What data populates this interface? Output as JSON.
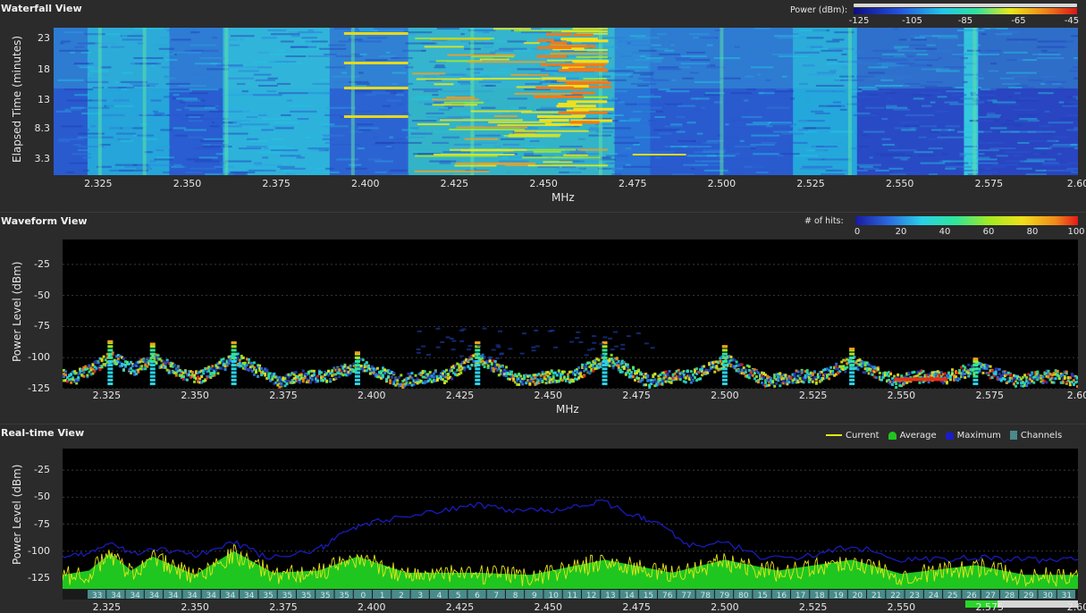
{
  "waterfall": {
    "title": "Waterfall View",
    "colorbar_label": "Power (dBm):",
    "colorbar_ticks": [
      "-125",
      "-105",
      "-85",
      "-65",
      "-45"
    ],
    "ylabel": "Elapsed Time (minutes)",
    "xlabel": "MHz"
  },
  "waveform": {
    "title": "Waveform View",
    "colorbar_label": "# of hits:",
    "colorbar_ticks": [
      "0",
      "20",
      "40",
      "60",
      "80",
      "100"
    ],
    "ylabel": "Power Level (dBm)",
    "xlabel": "MHz"
  },
  "realtime": {
    "title": "Real-time View",
    "ylabel": "Power Level (dBm)",
    "legend": [
      "Current",
      "Average",
      "Maximum",
      "Channels"
    ]
  },
  "colors": {
    "current": "#e6e619",
    "average": "#1fc61f",
    "maximum": "#1c1cc8",
    "channels": "#4a8a8a"
  },
  "chart_data": [
    {
      "type": "heatmap",
      "title": "Waterfall View",
      "ylabel": "Elapsed Time (minutes)",
      "xlabel": "MHz",
      "x_ticks": [
        "2.325",
        "2.350",
        "2.375",
        "2.400",
        "2.425",
        "2.450",
        "2.475",
        "2.500",
        "2.525",
        "2.550",
        "2.575",
        "2.60"
      ],
      "x_tick_values": [
        2.325,
        2.35,
        2.375,
        2.4,
        2.425,
        2.45,
        2.475,
        2.5,
        2.525,
        2.55,
        2.575,
        2.6
      ],
      "y_ticks": [
        "23",
        "18",
        "13",
        "8.3",
        "3.3"
      ],
      "y_tick_values": [
        23,
        18,
        13,
        8.3,
        3.3
      ],
      "xlim": [
        2.3125,
        2.6
      ],
      "ylim": [
        0.7,
        24.8
      ],
      "colorbar": {
        "label": "Power (dBm):",
        "ticks": [
          -125,
          -105,
          -85,
          -65,
          -45
        ]
      }
    },
    {
      "type": "heatmap",
      "title": "Waveform View",
      "ylabel": "Power Level (dBm)",
      "xlabel": "MHz",
      "x_ticks": [
        "2.325",
        "2.350",
        "2.375",
        "2.400",
        "2.425",
        "2.450",
        "2.475",
        "2.500",
        "2.525",
        "2.550",
        "2.575",
        "2.60"
      ],
      "x_tick_values": [
        2.325,
        2.35,
        2.375,
        2.4,
        2.425,
        2.45,
        2.475,
        2.5,
        2.525,
        2.55,
        2.575,
        2.6
      ],
      "y_ticks": [
        "-25",
        "-50",
        "-75",
        "-100",
        "-125"
      ],
      "y_tick_values": [
        -25,
        -50,
        -75,
        -100,
        -125
      ],
      "xlim": [
        2.3125,
        2.6
      ],
      "ylim": [
        -125,
        -5
      ],
      "colorbar": {
        "label": "# of hits:",
        "ticks": [
          0,
          20,
          40,
          60,
          80,
          100
        ]
      },
      "peaks": [
        {
          "x": 2.326,
          "y": -86
        },
        {
          "x": 2.338,
          "y": -88
        },
        {
          "x": 2.361,
          "y": -87
        },
        {
          "x": 2.396,
          "y": -95
        },
        {
          "x": 2.43,
          "y": -87
        },
        {
          "x": 2.466,
          "y": -87
        },
        {
          "x": 2.5,
          "y": -90
        },
        {
          "x": 2.536,
          "y": -92
        },
        {
          "x": 2.571,
          "y": -100
        }
      ]
    },
    {
      "type": "line",
      "title": "Real-time View",
      "ylabel": "Power Level (dBm)",
      "y_ticks": [
        "-25",
        "-50",
        "-75",
        "-100",
        "-125"
      ],
      "y_tick_values": [
        -25,
        -50,
        -75,
        -100,
        -125
      ],
      "xlim": [
        2.3125,
        2.6
      ],
      "ylim": [
        -135,
        -5
      ],
      "legend": "top-right",
      "series": [
        {
          "name": "Maximum",
          "x": [
            2.3125,
            2.32,
            2.326,
            2.332,
            2.338,
            2.35,
            2.361,
            2.37,
            2.384,
            2.39,
            2.397,
            2.405,
            2.42,
            2.43,
            2.44,
            2.45,
            2.458,
            2.466,
            2.475,
            2.482,
            2.49,
            2.5,
            2.51,
            2.525,
            2.536,
            2.55,
            2.56,
            2.571,
            2.58,
            2.59,
            2.6
          ],
          "values": [
            -105,
            -103,
            -92,
            -103,
            -96,
            -105,
            -92,
            -106,
            -100,
            -88,
            -76,
            -70,
            -63,
            -57,
            -62,
            -62,
            -58,
            -55,
            -68,
            -75,
            -95,
            -92,
            -105,
            -105,
            -95,
            -108,
            -108,
            -106,
            -108,
            -108,
            -108
          ]
        },
        {
          "name": "Average",
          "x": [
            2.3125,
            2.32,
            2.326,
            2.332,
            2.338,
            2.35,
            2.361,
            2.372,
            2.385,
            2.396,
            2.41,
            2.43,
            2.445,
            2.466,
            2.485,
            2.5,
            2.515,
            2.536,
            2.55,
            2.571,
            2.585,
            2.6
          ],
          "values": [
            -122,
            -118,
            -102,
            -118,
            -105,
            -122,
            -100,
            -120,
            -118,
            -105,
            -120,
            -120,
            -122,
            -108,
            -120,
            -108,
            -118,
            -108,
            -121,
            -113,
            -122,
            -122
          ]
        }
      ],
      "channels": [
        "33",
        "34",
        "34",
        "34",
        "34",
        "34",
        "34",
        "34",
        "34",
        "35",
        "35",
        "35",
        "35",
        "35",
        "0",
        "1",
        "2",
        "3",
        "4",
        "5",
        "6",
        "7",
        "8",
        "9",
        "10",
        "11",
        "12",
        "13",
        "14",
        "15",
        "76",
        "77",
        "78",
        "79",
        "80",
        "15",
        "16",
        "17",
        "18",
        "19",
        "20",
        "21",
        "22",
        "23",
        "24",
        "25",
        "26",
        "27",
        "28",
        "29",
        "30",
        "31"
      ]
    }
  ]
}
